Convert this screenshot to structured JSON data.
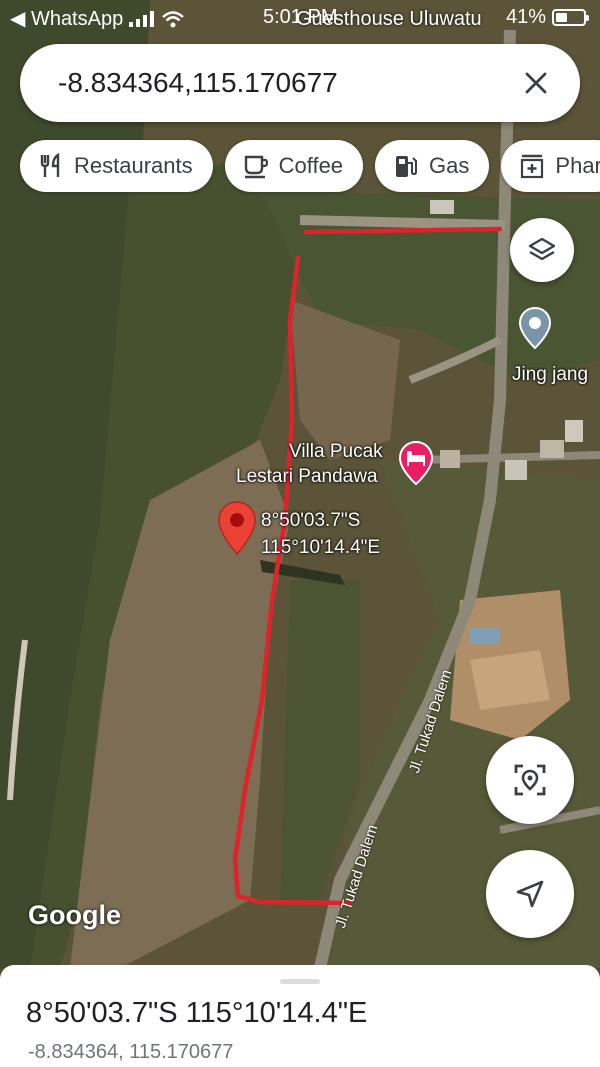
{
  "status_bar": {
    "back_app": "◀ WhatsApp",
    "time": "5:01 PM",
    "battery": "41%",
    "battery_level": 0.41
  },
  "map_top_place": "Guesthouse Uluwatu",
  "search": {
    "query": "-8.834364,115.170677"
  },
  "chips": [
    {
      "label": "Restaurants",
      "icon": "fork-knife-icon"
    },
    {
      "label": "Coffee",
      "icon": "coffee-icon"
    },
    {
      "label": "Gas",
      "icon": "gas-pump-icon"
    },
    {
      "label": "Phar",
      "icon": "pharmacy-icon"
    }
  ],
  "map": {
    "labels": {
      "jing_jang": "Jing jang",
      "villa_line1": "Villa Pucak",
      "villa_line2": "Lestari Pandawa",
      "coord_dms_lat": "8°50'03.7\"S",
      "coord_dms_lon": "115°10'14.4\"E",
      "road_upper": "Jl. Tukad Dalem",
      "road_lower": "Jl. Tukad Dalem"
    },
    "attribution": "Google",
    "colors": {
      "annotation_red": "#e0222b",
      "pin_red": "#ea4335",
      "hotel_pink": "#e91e63",
      "place_pin_gray": "#7a94a8"
    }
  },
  "sheet": {
    "coords_dms": "8°50'03.7\"S 115°10'14.4\"E",
    "coords_decimal": "-8.834364, 115.170677"
  }
}
